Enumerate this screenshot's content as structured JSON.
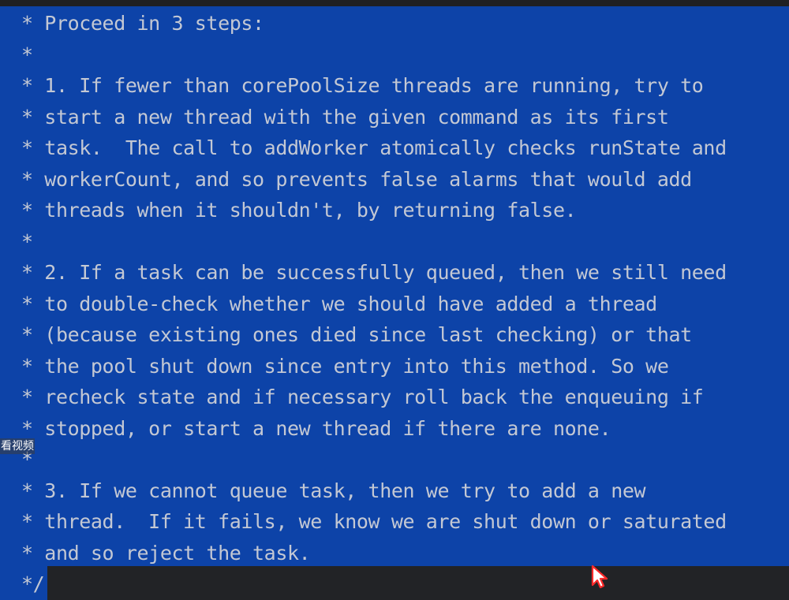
{
  "editor": {
    "lines": [
      "* Proceed in 3 steps:",
      "*",
      "* 1. If fewer than corePoolSize threads are running, try to",
      "* start a new thread with the given command as its first",
      "* task.  The call to addWorker atomically checks runState and",
      "* workerCount, and so prevents false alarms that would add",
      "* threads when it shouldn't, by returning false.",
      "*",
      "* 2. If a task can be successfully queued, then we still need",
      "* to double-check whether we should have added a thread",
      "* (because existing ones died since last checking) or that",
      "* the pool shut down since entry into this method. So we",
      "* recheck state and if necessary roll back the enqueuing if",
      "* stopped, or start a new thread if there are none.",
      "*",
      "* 3. If we cannot queue task, then we try to add a new",
      "* thread.  If it fails, we know we are shut down or saturated",
      "* and so reject the task.",
      "*/"
    ],
    "selection_color": "#0d43a8",
    "text_color": "#c3c8d4"
  },
  "overlay": {
    "label": "看视频"
  },
  "pointer": {
    "icon": "mouse-pointer-icon",
    "color": "#ff2a2a"
  }
}
